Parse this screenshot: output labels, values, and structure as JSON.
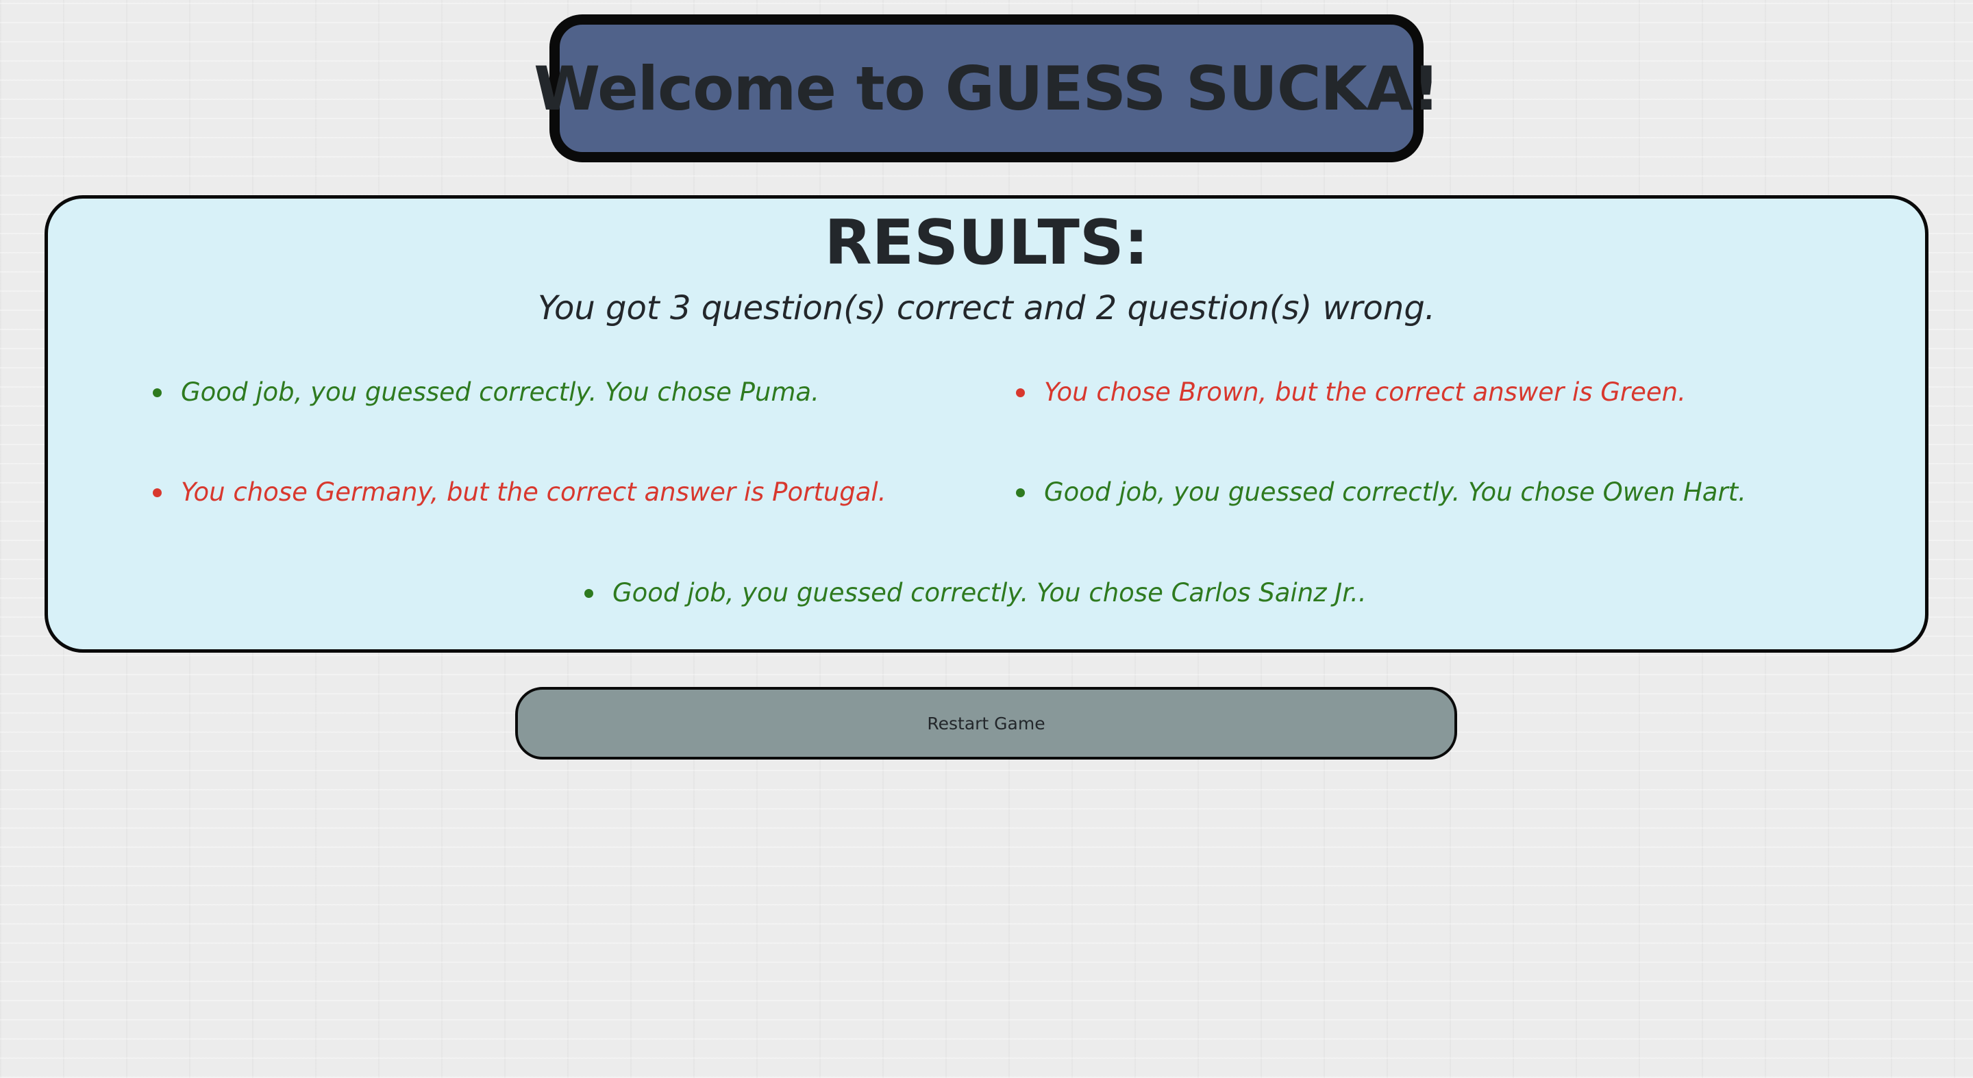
{
  "header": {
    "title": "Welcome to GUESS SUCKA!"
  },
  "results": {
    "heading": "RESULTS:",
    "summary": "You got 3 question(s) correct and 2 question(s) wrong.",
    "items": [
      {
        "text": "Good job, you guessed correctly. You chose Puma.",
        "status": "correct"
      },
      {
        "text": "You chose Brown, but the correct answer is Green.",
        "status": "wrong"
      },
      {
        "text": "You chose Germany, but the correct answer is Portugal.",
        "status": "wrong"
      },
      {
        "text": "Good job, you guessed correctly. You chose Owen Hart.",
        "status": "correct"
      },
      {
        "text": "Good job, you guessed correctly. You chose Carlos Sainz Jr..",
        "status": "correct"
      }
    ]
  },
  "restart_button": {
    "label": "Restart Game"
  },
  "colors": {
    "header_background": "#50628a",
    "results_background": "#d8f1f8",
    "correct": "#2e7a1f",
    "wrong": "#d8382e",
    "button_background": "#889899"
  }
}
